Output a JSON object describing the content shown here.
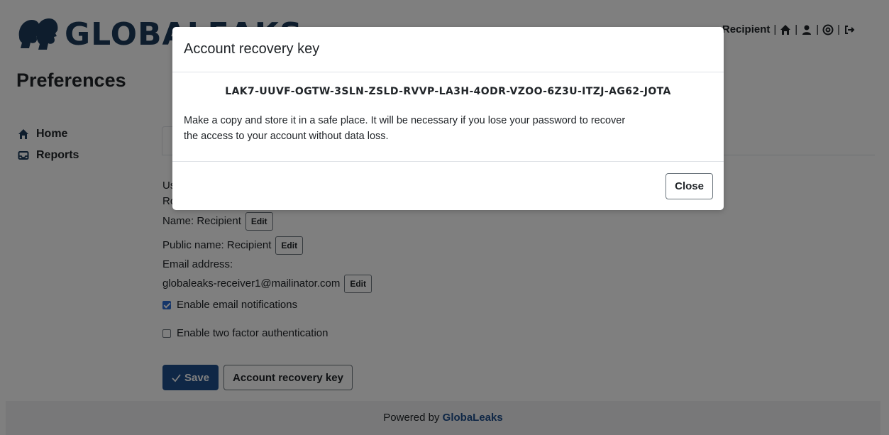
{
  "header": {
    "logo_text": "GLOBALEAKS",
    "user_label": "Recipient",
    "separator": "|"
  },
  "page": {
    "title": "Preferences"
  },
  "sidebar": {
    "items": [
      {
        "label": "Home",
        "icon": "home-icon"
      },
      {
        "label": "Reports",
        "icon": "inbox-icon"
      }
    ]
  },
  "preferences": {
    "username_label_partial": "Us",
    "role_label_partial": "Ro",
    "name_text": "Name: Recipient",
    "public_name_text": "Public name: Recipient",
    "email_label": "Email address:",
    "email_value": "globaleaks-receiver1@mailinator.com",
    "edit_label": "Edit",
    "email_notifications_label": "Enable email notifications",
    "email_notifications_checked": true,
    "two_factor_label": "Enable two factor authentication",
    "two_factor_checked": false,
    "save_label": "Save",
    "recovery_key_button_label": "Account recovery key"
  },
  "footer": {
    "powered_prefix": "Powered by",
    "powered_brand": "GlobaLeaks"
  },
  "modal": {
    "title": "Account recovery key",
    "recovery_key": "LAK7-UUVF-OGTW-3SLN-ZSLD-RVVP-LA3H-4ODR-VZOO-6Z3U-ITZJ-AG62-JOTA",
    "message_line1": "Make a copy and store it in a safe place. It will be necessary if you lose your password to recover",
    "message_line2": "the access to your account without data loss.",
    "close_label": "Close"
  },
  "colors": {
    "primary": "#1e4e8c",
    "backdrop": "rgba(0,0,0,0.5)",
    "footer_bg": "#f0f1f2"
  }
}
